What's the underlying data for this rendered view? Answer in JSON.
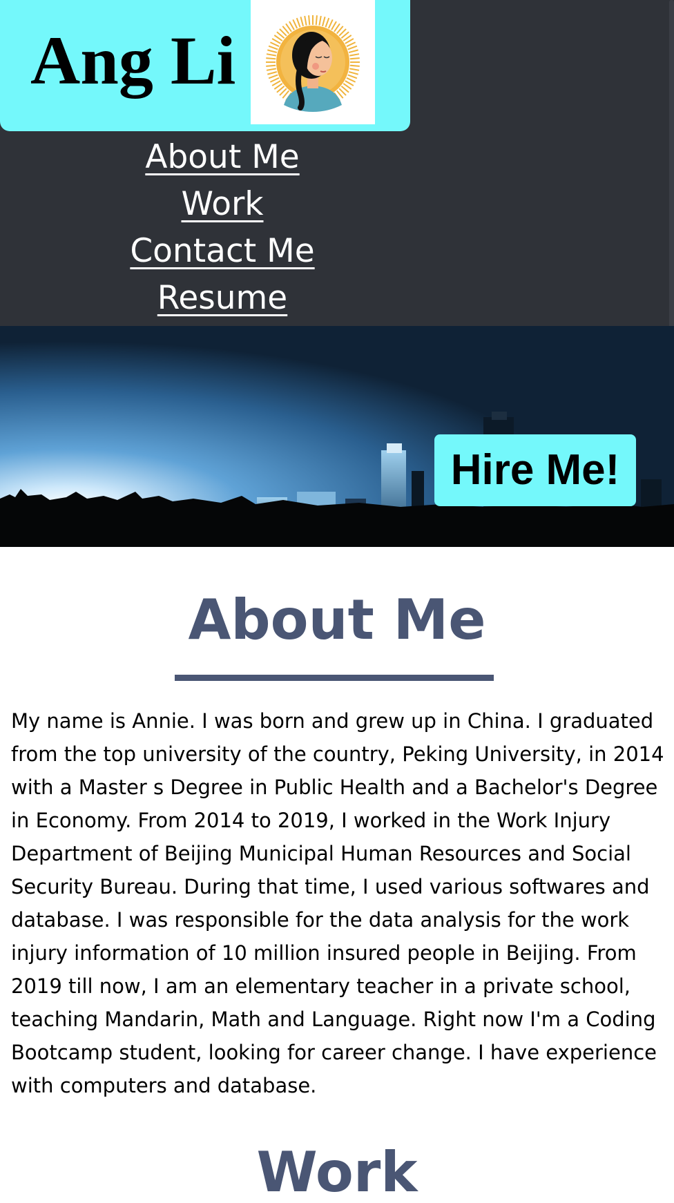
{
  "brand": {
    "name": "Ang Li",
    "avatar_icon": "woman-portrait-icon"
  },
  "nav": {
    "items": [
      {
        "label": "About Me"
      },
      {
        "label": "Work"
      },
      {
        "label": "Contact Me"
      },
      {
        "label": "Resume"
      }
    ]
  },
  "hero": {
    "image": "city-skyline-image",
    "cta_label": "Hire Me!"
  },
  "about": {
    "title": "About Me",
    "body": "My name is Annie. I was born and grew up in China. I graduated from the top university of the country, Peking University, in 2014 with a Master s Degree in Public Health and a Bachelor's Degree in Economy. From 2014 to 2019, I worked in the Work Injury Department of Beijing Municipal Human Resources and Social Security Bureau. During that time, I used various softwares and database. I was responsible for the data analysis for the work injury information of 10 million insured people in Beijing. From 2019 till now, I am an elementary teacher in a private school, teaching Mandarin, Math and Language. Right now I'm a Coding Bootcamp student, looking for career change. I have experience with computers and database."
  },
  "work": {
    "title": "Work"
  },
  "colors": {
    "accent": "#74f8fb",
    "header_bg": "#2f3238",
    "heading": "#4a5674"
  }
}
